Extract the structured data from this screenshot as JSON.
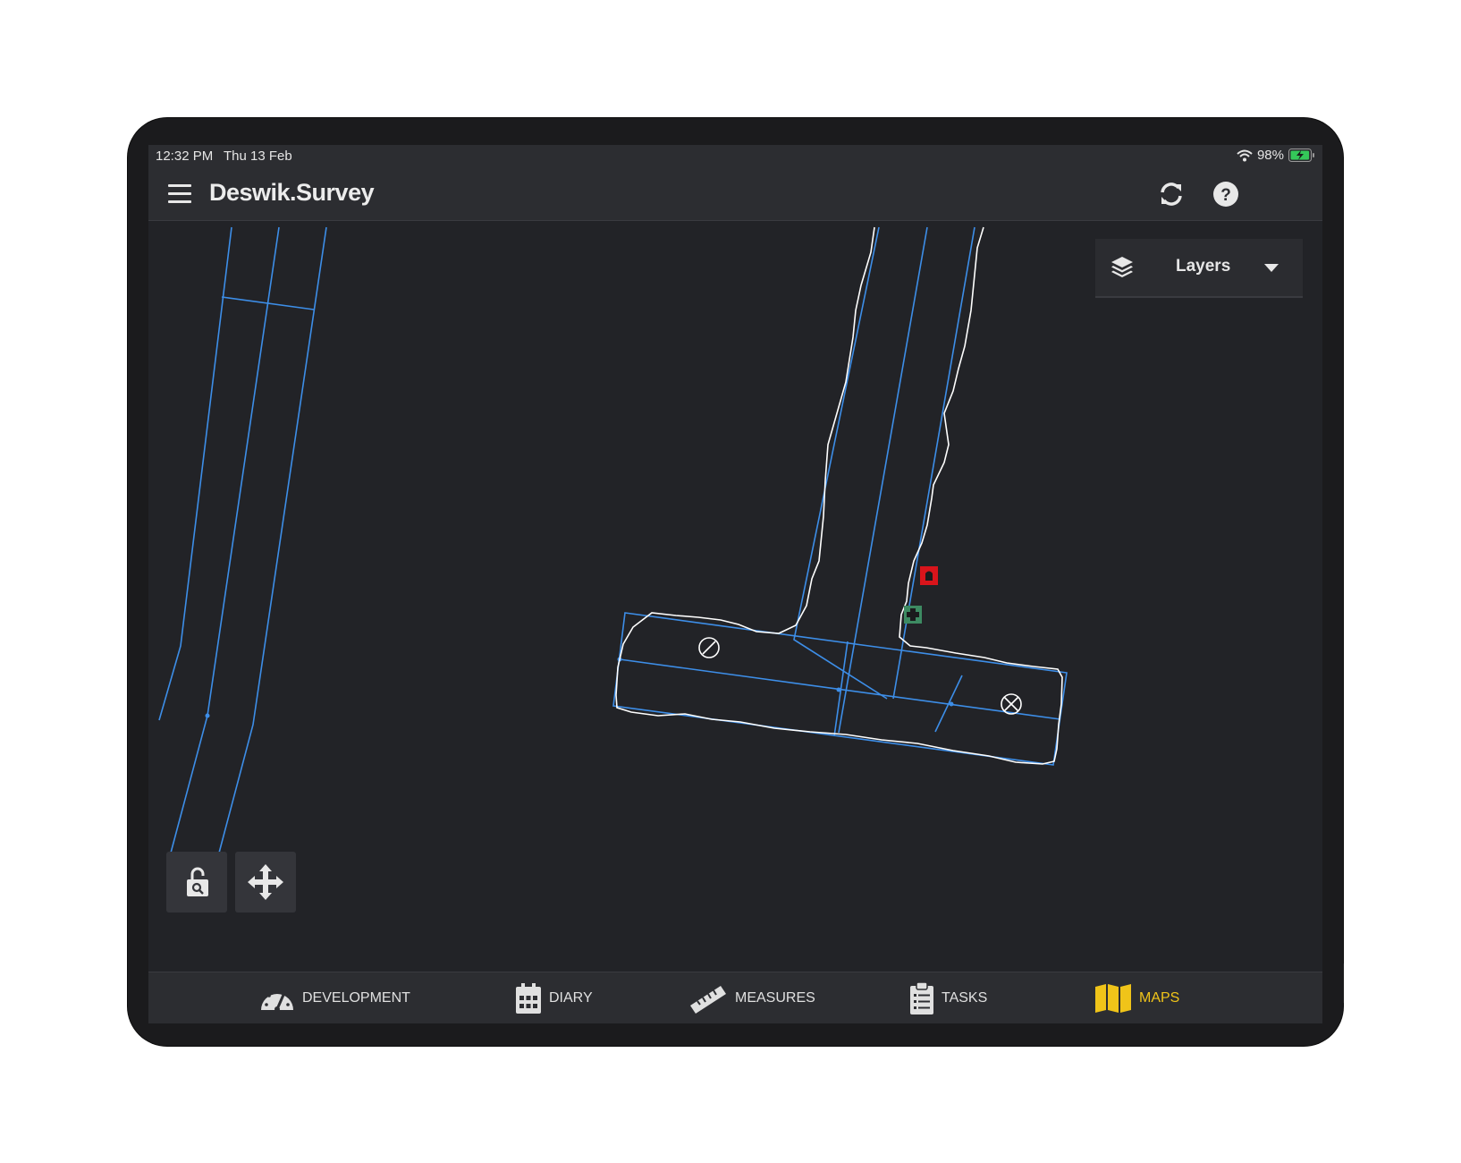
{
  "status_bar": {
    "time": "12:32 PM",
    "date": "Thu 13 Feb",
    "battery_percent": "98%",
    "battery_level": 0.98,
    "wifi_icon": "wifi-icon",
    "battery_icon": "battery-charging-icon"
  },
  "app_bar": {
    "title": "Deswik.Survey",
    "menu_icon": "hamburger-menu-icon",
    "sync_icon": "sync-icon",
    "help_icon": "help-icon"
  },
  "layers_dropdown": {
    "label": "Layers",
    "icon": "layers-icon"
  },
  "map_tools": {
    "lock_icon": "unlock-search-icon",
    "pan_icon": "move-arrows-icon"
  },
  "map_markers": {
    "red_marker_icon": "refuge-chamber-icon",
    "green_marker_icon": "first-aid-icon"
  },
  "tabs": [
    {
      "label": "DEVELOPMENT",
      "icon": "gauge-icon",
      "active": false
    },
    {
      "label": "DIARY",
      "icon": "calendar-icon",
      "active": false
    },
    {
      "label": "MEASURES",
      "icon": "ruler-icon",
      "active": false
    },
    {
      "label": "TASKS",
      "icon": "clipboard-icon",
      "active": false
    },
    {
      "label": "MAPS",
      "icon": "map-icon",
      "active": true
    }
  ],
  "colors": {
    "accent_active": "#f0c419",
    "map_line": "#3d8ee8",
    "map_outline": "#ffffff",
    "background": "#222327",
    "marker_red": "#d9141b",
    "marker_green": "#3d8a62"
  }
}
